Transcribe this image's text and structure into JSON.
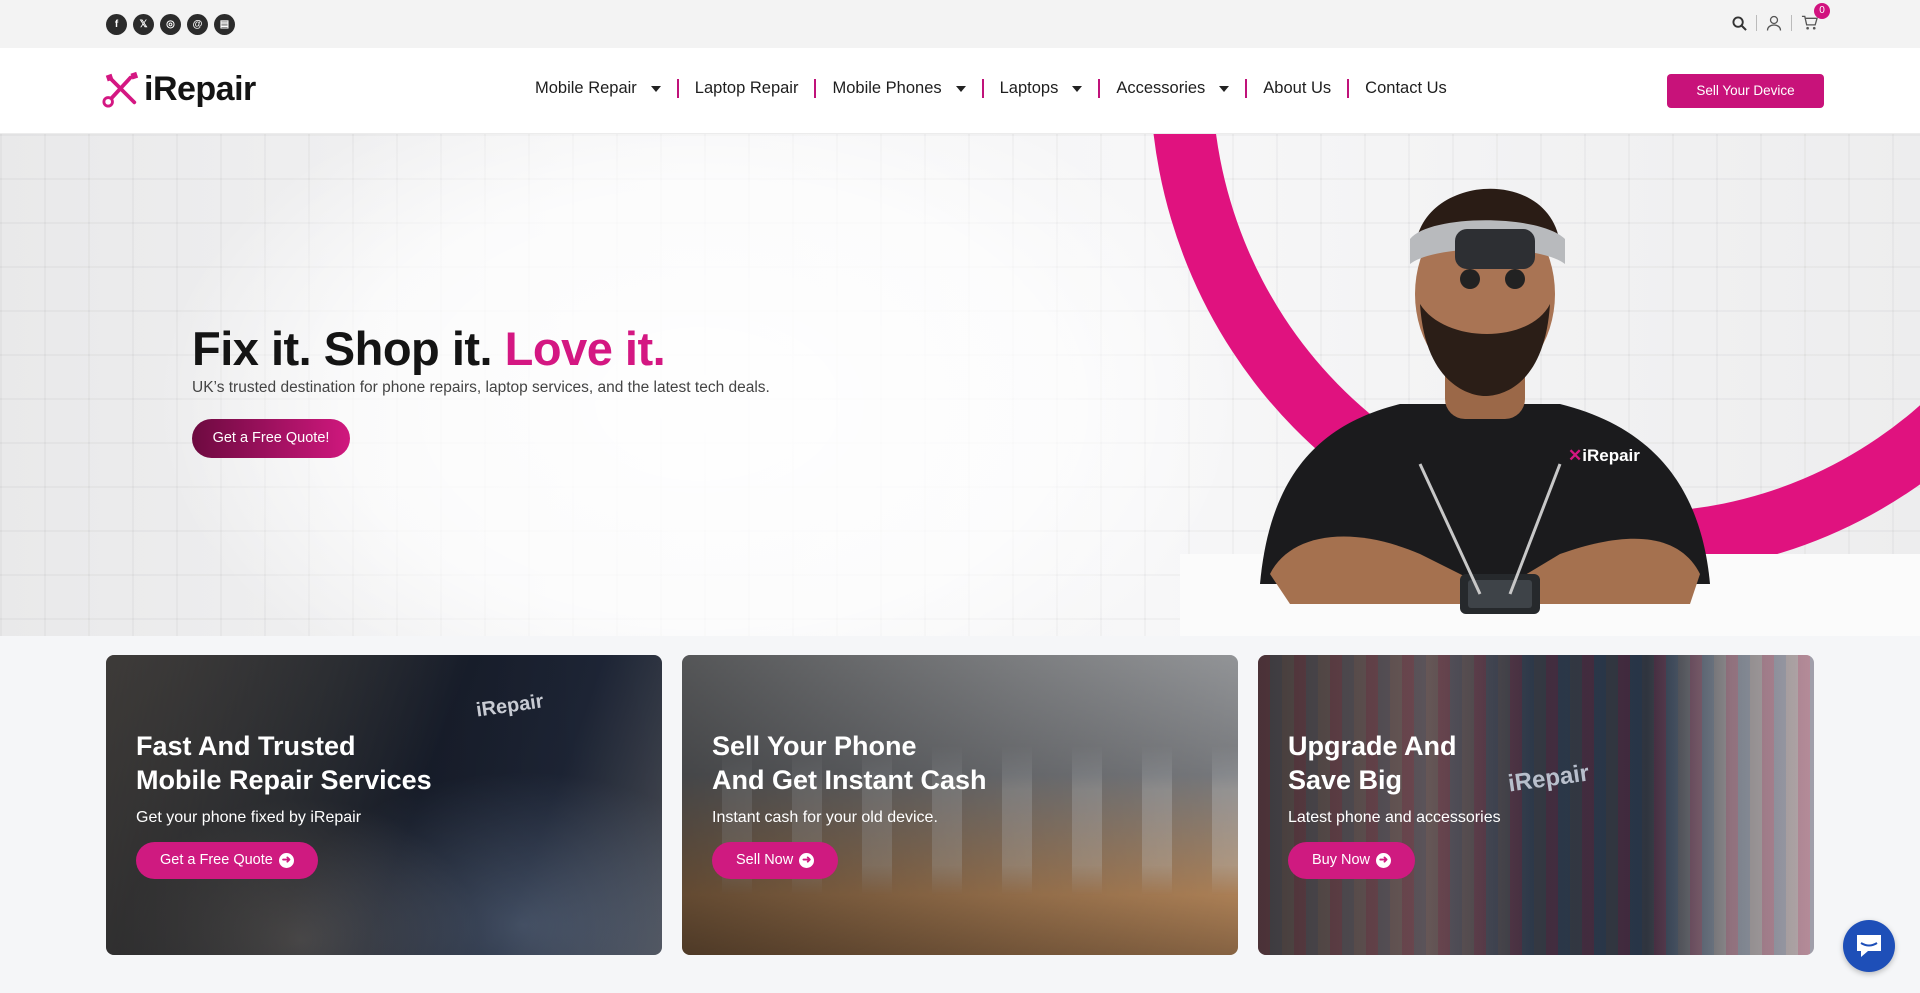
{
  "topbar": {
    "social": [
      {
        "icon": "facebook-icon",
        "glyph": "f"
      },
      {
        "icon": "x-icon",
        "glyph": "𝕏"
      },
      {
        "icon": "instagram-icon",
        "glyph": "◎"
      },
      {
        "icon": "threads-icon",
        "glyph": "@"
      },
      {
        "icon": "blog-icon",
        "glyph": "▤"
      }
    ],
    "cart_count": "0"
  },
  "header": {
    "logo_text": "iRepair",
    "nav": [
      {
        "label": "Mobile Repair",
        "dropdown": true
      },
      {
        "label": "Laptop Repair",
        "dropdown": false
      },
      {
        "label": "Mobile Phones",
        "dropdown": true
      },
      {
        "label": "Laptops",
        "dropdown": true
      },
      {
        "label": "Accessories",
        "dropdown": true
      },
      {
        "label": "About Us",
        "dropdown": false
      },
      {
        "label": "Contact Us",
        "dropdown": false
      }
    ],
    "sell_button": "Sell Your Device"
  },
  "hero": {
    "headline_dark": "Fix it. Shop it.",
    "headline_pink": "Love it.",
    "subline": "UK’s trusted destination for phone repairs, laptop services, and the latest tech deals.",
    "cta": "Get a Free Quote!",
    "shirt_logo": "iRepair"
  },
  "cards": [
    {
      "title_line1": "Fast And Trusted",
      "title_line2": "Mobile Repair Services",
      "text": "Get your phone fixed by iRepair",
      "button": "Get a Free Quote",
      "jacket_logo": "iRepair"
    },
    {
      "title_line1": "Sell Your Phone",
      "title_line2": "And Get Instant Cash",
      "text": "Instant cash for your old device.",
      "button": "Sell Now"
    },
    {
      "title_line1": "Upgrade And",
      "title_line2": "Save Big",
      "text": "Latest phone and accessories",
      "button": "Buy Now",
      "jacket_logo": "iRepair"
    }
  ],
  "colors": {
    "brand_pink": "#d41782",
    "button_pink": "#c8127a",
    "chat_blue": "#1e4fb8"
  }
}
